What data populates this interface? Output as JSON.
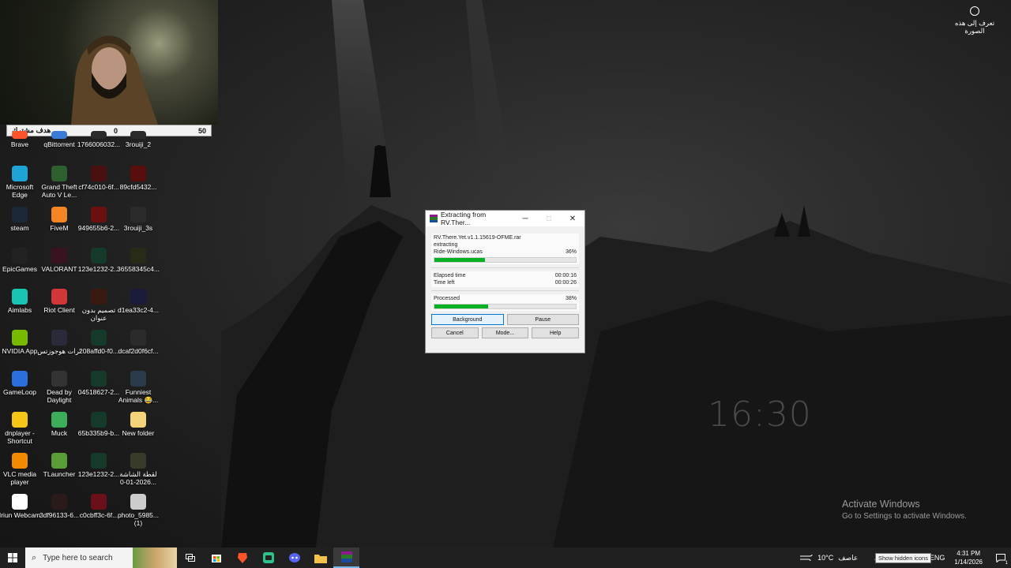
{
  "webcam_goal": {
    "label": "هدف مشترك",
    "current": "0",
    "target": "50"
  },
  "desktop_icons": [
    {
      "label": "Brave",
      "icon": "brave-icon",
      "color": "#fb542b"
    },
    {
      "label": "qBittorrent",
      "icon": "qbittorrent-icon",
      "color": "#3a7bd5"
    },
    {
      "label": "1766006032...",
      "icon": "image-file-icon",
      "color": "#2b2b2b"
    },
    {
      "label": "3rouiji_2",
      "icon": "image-file-icon",
      "color": "#2b2b2b"
    },
    {
      "label": "Microsoft Edge",
      "icon": "edge-icon",
      "color": "#1fa2d6"
    },
    {
      "label": "Grand Theft Auto V Le...",
      "icon": "gta-icon",
      "color": "#2e5f2e"
    },
    {
      "label": "cf74c010-6f...",
      "icon": "image-file-icon",
      "color": "#4a1010"
    },
    {
      "label": "89cfd5432...",
      "icon": "image-file-icon",
      "color": "#5a0d0d"
    },
    {
      "label": "steam",
      "icon": "steam-icon",
      "color": "#1b2838"
    },
    {
      "label": "FiveM",
      "icon": "fivem-icon",
      "color": "#f48524"
    },
    {
      "label": "949655b6-2...",
      "icon": "image-file-icon",
      "color": "#6a1010"
    },
    {
      "label": "3rouiji_3s",
      "icon": "image-file-icon",
      "color": "#2b2b2b"
    },
    {
      "label": "EpicGames",
      "icon": "epic-games-icon",
      "color": "#222222"
    },
    {
      "label": "VALORANT",
      "icon": "valorant-icon",
      "color": "#3a1320"
    },
    {
      "label": "123e1232-2...",
      "icon": "image-file-icon",
      "color": "#153a2a"
    },
    {
      "label": "36558345c4...",
      "icon": "image-file-icon",
      "color": "#2a2a18"
    },
    {
      "label": "Aimlabs",
      "icon": "aimlabs-icon",
      "color": "#19c4b3"
    },
    {
      "label": "Riot Client",
      "icon": "riot-icon",
      "color": "#d13639"
    },
    {
      "label": "تصميم بدون عنوان",
      "icon": "image-file-icon",
      "color": "#3a1a10"
    },
    {
      "label": "d1ea33c2-4...",
      "icon": "image-file-icon",
      "color": "#1a1a3a"
    },
    {
      "label": "NVIDIA App",
      "icon": "nvidia-icon",
      "color": "#76b900"
    },
    {
      "label": "ثرات هوجوزتس",
      "icon": "game-icon",
      "color": "#2a2a3a"
    },
    {
      "label": "208affd0-f0...",
      "icon": "image-file-icon",
      "color": "#153a2a"
    },
    {
      "label": "dcaf2d0f6cf...",
      "icon": "image-file-icon",
      "color": "#2b2b2b"
    },
    {
      "label": "GameLoop",
      "icon": "gameloop-icon",
      "color": "#2a6fdb"
    },
    {
      "label": "Dead by Daylight",
      "icon": "dbd-icon",
      "color": "#333333"
    },
    {
      "label": "04518627-2...",
      "icon": "image-file-icon",
      "color": "#153a2a"
    },
    {
      "label": "Funniest Animals 😂...",
      "icon": "video-file-icon",
      "color": "#2a3a4a"
    },
    {
      "label": "dnplayer - Shortcut",
      "icon": "ldplayer-icon",
      "color": "#f5c518"
    },
    {
      "label": "Muck",
      "icon": "muck-icon",
      "color": "#3cae5a"
    },
    {
      "label": "65b335b9-b...",
      "icon": "image-file-icon",
      "color": "#153a2a"
    },
    {
      "label": "New folder",
      "icon": "folder-icon",
      "color": "#f3d37a"
    },
    {
      "label": "VLC media player",
      "icon": "vlc-icon",
      "color": "#f18a00"
    },
    {
      "label": "TLauncher",
      "icon": "tlauncher-icon",
      "color": "#5a9c35"
    },
    {
      "label": "123e1232-2...",
      "icon": "image-file-icon",
      "color": "#153a2a"
    },
    {
      "label": "لقطة الشاشة 2026-01-0...",
      "icon": "image-file-icon",
      "color": "#3a3a2a"
    },
    {
      "label": "Iriun Webcam",
      "icon": "iriun-icon",
      "color": "#ffffff"
    },
    {
      "label": "3df96133-6...",
      "icon": "image-file-icon",
      "color": "#2a1a1a"
    },
    {
      "label": "c0cbff3c-6f...",
      "icon": "image-file-icon",
      "color": "#6a1018"
    },
    {
      "label": "photo_5985... (1)",
      "icon": "image-file-icon",
      "color": "#cccccc"
    }
  ],
  "corner_info": {
    "label": "تعرف إلى هذه الصورة",
    "icon": "camera-icon"
  },
  "desktop_clock": "16:30",
  "activation": {
    "title": "Activate Windows",
    "subtitle": "Go to Settings to activate Windows."
  },
  "dialog": {
    "title": "Extracting from RV.Ther...",
    "archive": "RV.There.Yet.v1.1.15619-OFME.rar",
    "action": "extracting",
    "current_file": "Ride-Windows.ucas",
    "file_percent_label": "36%",
    "file_progress": 0.36,
    "elapsed_label": "Elapsed time",
    "elapsed_value": "00:00:16",
    "left_label": "Time left",
    "left_value": "00:00:26",
    "processed_label": "Processed",
    "processed_percent_label": "38%",
    "processed_progress": 0.38,
    "buttons": {
      "background": "Background",
      "pause": "Pause",
      "cancel": "Cancel",
      "mode": "Mode...",
      "help": "Help"
    }
  },
  "taskbar": {
    "search_placeholder": "Type here to search",
    "apps": [
      "task-view-icon",
      "microsoft-store-icon",
      "brave-icon",
      "chat-app-icon",
      "discord-icon",
      "file-explorer-icon",
      "winrar-icon"
    ],
    "weather_temp": "10°C",
    "weather_desc": "عاصف",
    "tooltip": "Show hidden icons",
    "lang": "ENG",
    "time": "4:31 PM",
    "date": "1/14/2026",
    "notification_count": "1"
  }
}
